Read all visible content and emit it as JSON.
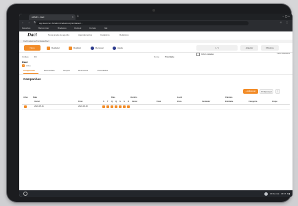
{
  "browser": {
    "tab_title": "ADMIN - Dacl",
    "url": "app.lead.com.br/admin/cadastros/prioridades/..."
  },
  "bookmarks": [
    "Favoritos",
    "Banco Inter",
    "Bradesco",
    "Outlook",
    "Correio",
    "GE"
  ],
  "app": {
    "logo": "Dacl",
    "nav": [
      "Nova janela de agenda",
      "Agendamentos",
      "Cadastros",
      "Relatórios"
    ],
    "breadcrumb": "Dacl/Cadastros/Prioridades/Dacl"
  },
  "toolbar": {
    "new_label": "Novo",
    "buttons": [
      "Desfazer",
      "Duplicar",
      "Remover",
      "Ajuda"
    ],
    "pager_text": "1 / 1",
    "prev_label": "Anterior",
    "next_label": "Próximo",
    "filter_label": "Incluir anuladas",
    "filter_right": "Incluir obsoletos"
  },
  "form": {
    "code_label": "Código",
    "code_value": "19",
    "name_label": "Nome",
    "name_value": "Prioridade",
    "title": "Dacl",
    "active_label": "Ativo"
  },
  "tabs": [
    "Campanhas",
    "Permissões",
    "Grupos",
    "Descontos",
    "Prioridades"
  ],
  "section": {
    "title": "Campanhas",
    "add_label": "Adicionar",
    "remove_label": "Remover"
  },
  "table": {
    "group_headers": [
      "Ativo",
      "Data",
      "Dias",
      "Horário",
      "Local",
      "Clientes"
    ],
    "columns": [
      "Inicial",
      "Final",
      "S",
      "T",
      "Q",
      "Q",
      "S",
      "S",
      "D",
      "Inicial",
      "Final",
      "Zona",
      "Vendedor",
      "Entidade",
      "Categoria",
      "Grupo"
    ],
    "rows": [
      {
        "inicial": "2022-05-31",
        "final": "2022-06-30"
      }
    ]
  },
  "taskbar": {
    "date": "20 de mai.",
    "time": "14:15"
  }
}
